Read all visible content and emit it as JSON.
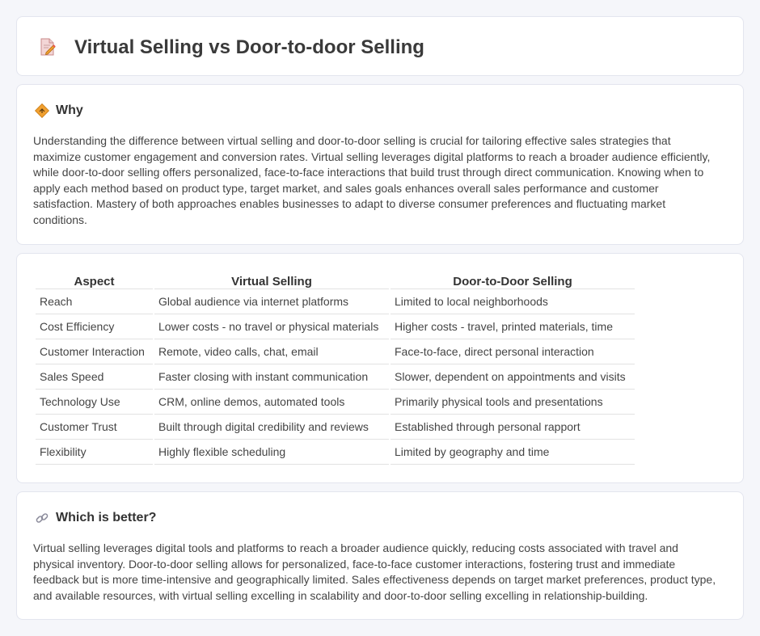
{
  "header": {
    "title": "Virtual Selling vs Door-to-door Selling",
    "icon": "document-pen-icon"
  },
  "why": {
    "title": "Why",
    "icon": "diamond-direction-icon",
    "text": "Understanding the difference between virtual selling and door-to-door selling is crucial for tailoring effective sales strategies that maximize customer engagement and conversion rates. Virtual selling leverages digital platforms to reach a broader audience efficiently, while door-to-door selling offers personalized, face-to-face interactions that build trust through direct communication. Knowing when to apply each method based on product type, target market, and sales goals enhances overall sales performance and customer satisfaction. Mastery of both approaches enables businesses to adapt to diverse consumer preferences and fluctuating market conditions."
  },
  "table": {
    "headers": [
      "Aspect",
      "Virtual Selling",
      "Door-to-Door Selling"
    ],
    "rows": [
      [
        "Reach",
        "Global audience via internet platforms",
        "Limited to local neighborhoods"
      ],
      [
        "Cost Efficiency",
        "Lower costs - no travel or physical materials",
        "Higher costs - travel, printed materials, time"
      ],
      [
        "Customer Interaction",
        "Remote, video calls, chat, email",
        "Face-to-face, direct personal interaction"
      ],
      [
        "Sales Speed",
        "Faster closing with instant communication",
        "Slower, dependent on appointments and visits"
      ],
      [
        "Technology Use",
        "CRM, online demos, automated tools",
        "Primarily physical tools and presentations"
      ],
      [
        "Customer Trust",
        "Built through digital credibility and reviews",
        "Established through personal rapport"
      ],
      [
        "Flexibility",
        "Highly flexible scheduling",
        "Limited by geography and time"
      ]
    ]
  },
  "better": {
    "title": "Which is better?",
    "icon": "link-icon",
    "text": "Virtual selling leverages digital tools and platforms to reach a broader audience quickly, reducing costs associated with travel and physical inventory. Door-to-door selling allows for personalized, face-to-face customer interactions, fostering trust and immediate feedback but is more time-intensive and geographically limited. Sales effectiveness depends on target market preferences, product type, and available resources, with virtual selling excelling in scalability and door-to-door selling excelling in relationship-building."
  },
  "colors": {
    "background": "#f5f6fa",
    "card": "#ffffff",
    "border": "#e3e5ee",
    "accent_orange": "#f0a030"
  }
}
